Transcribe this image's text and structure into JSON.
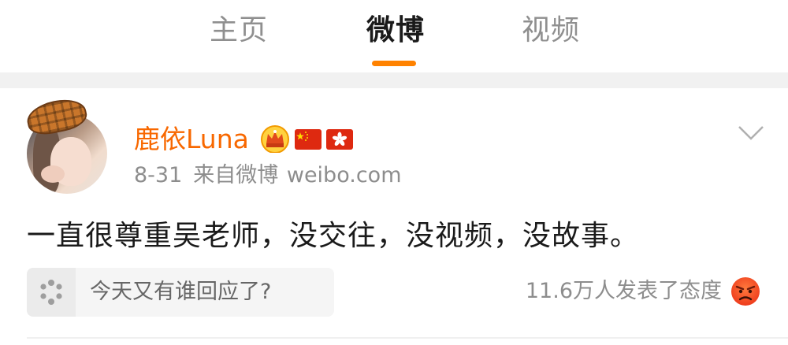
{
  "tabs": [
    {
      "label": "主页",
      "active": false
    },
    {
      "label": "微博",
      "active": true
    },
    {
      "label": "视频",
      "active": false
    }
  ],
  "accent_color": "#ff8200",
  "post": {
    "username": "鹿依Luna",
    "username_color": "#f86800",
    "badges": [
      "crown-icon",
      "china-flag-icon",
      "hong-kong-flag-icon"
    ],
    "date": "8-31",
    "source": "来自微博 weibo.com",
    "text": "一直很尊重吴老师，没交往，没视频，没故事。",
    "reaction_prompt": "今天又有谁回应了?",
    "reaction_count": "11.6万人发表了态度",
    "reaction_icon": "angry-face-icon"
  }
}
